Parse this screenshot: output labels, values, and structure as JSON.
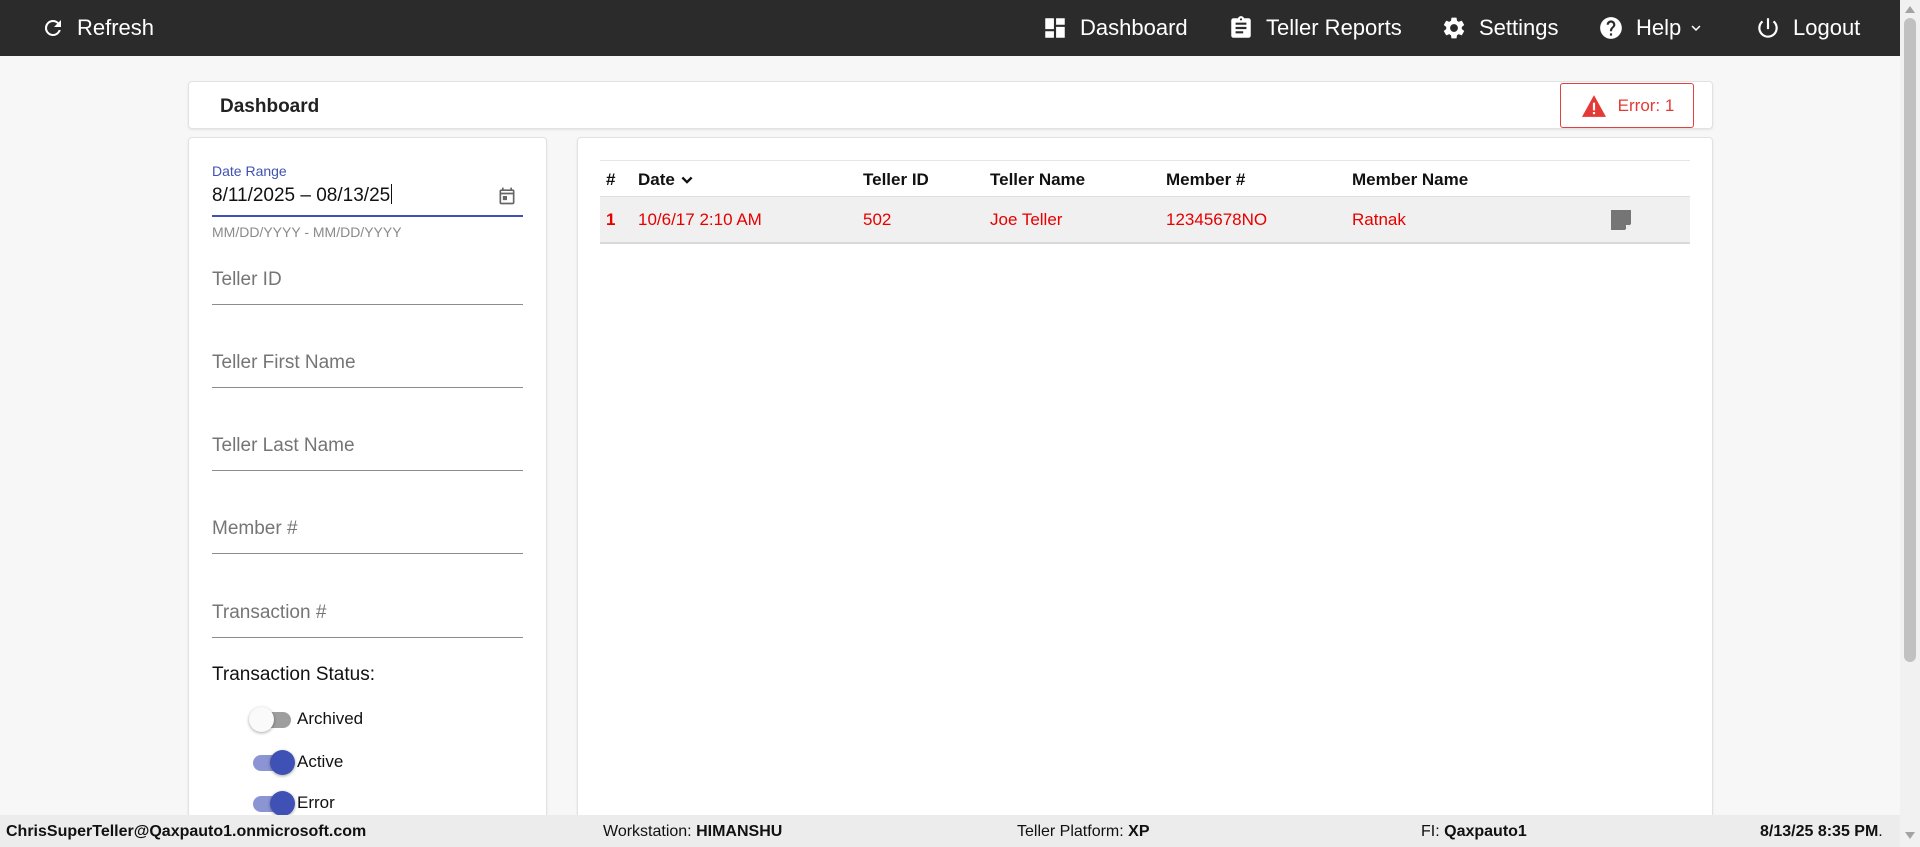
{
  "nav": {
    "refresh": "Refresh",
    "dashboard": "Dashboard",
    "teller_reports": "Teller Reports",
    "settings": "Settings",
    "help": "Help",
    "logout": "Logout"
  },
  "header": {
    "title": "Dashboard",
    "error_badge": "Error: 1"
  },
  "filters": {
    "date_range_label": "Date Range",
    "date_range_value": "8/11/2025 – 08/13/25",
    "date_range_hint": "MM/DD/YYYY - MM/DD/YYYY",
    "teller_id_placeholder": "Teller ID",
    "teller_first_name_placeholder": "Teller First Name",
    "teller_last_name_placeholder": "Teller Last Name",
    "member_number_placeholder": "Member #",
    "transaction_number_placeholder": "Transaction #",
    "status_title": "Transaction Status:",
    "toggles": [
      {
        "label": "Archived",
        "on": false
      },
      {
        "label": "Active",
        "on": true
      },
      {
        "label": "Error",
        "on": true
      }
    ]
  },
  "table": {
    "columns": [
      "#",
      "Date",
      "Teller ID",
      "Teller Name",
      "Member #",
      "Member Name"
    ],
    "rows": [
      {
        "num": "1",
        "date": "10/6/17 2:10 AM",
        "teller_id": "502",
        "teller_name": "Joe Teller",
        "member_number": "12345678NO",
        "member_name": "Ratnak"
      }
    ]
  },
  "footer": {
    "user": "ChrisSuperTeller@Qaxpauto1.onmicrosoft.com",
    "workstation_label": "Workstation:",
    "workstation": "HIMANSHU",
    "platform_label": "Teller Platform:",
    "platform": "XP",
    "fi_label": "FI:",
    "fi": "Qaxpauto1",
    "datetime": "8/13/25 8:35 PM",
    "datetime_suffix": "."
  },
  "colors": {
    "topbar": "#2b2b2b",
    "accent": "#3f51b5",
    "error": "#e60000"
  }
}
